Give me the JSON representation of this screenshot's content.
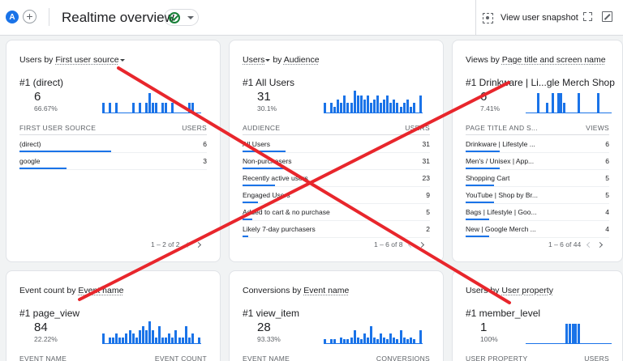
{
  "header": {
    "avatar_letter": "A",
    "add_label": "+",
    "title": "Realtime overview",
    "snapshot_label": "View user snapshot"
  },
  "colors": {
    "accent": "#1a73e8",
    "cross": "#e8262c",
    "status_ok": "#188038"
  },
  "cards": [
    {
      "title_a": "Users by ",
      "title_b": "First user source",
      "top_rank": "#1  (direct)",
      "top_value": "6",
      "top_percent": "66.67%",
      "col1": "FIRST USER SOURCE",
      "col2": "USERS",
      "rows": [
        {
          "name": "(direct)",
          "value": "6",
          "share": 0.67
        },
        {
          "name": "google",
          "value": "3",
          "share": 0.33
        }
      ],
      "pager": "1 – 2 of 2",
      "spark": [
        0.45,
        0,
        0.45,
        0,
        0.45,
        0,
        0,
        0,
        0,
        0.45,
        0,
        0.45,
        0,
        0.45,
        0.9,
        0.45,
        0.45,
        0,
        0.45,
        0.45,
        0,
        0.45,
        0,
        0,
        0,
        0,
        0.45,
        0.45,
        0,
        0
      ]
    },
    {
      "title_a": "Users",
      "title_b": "Audience",
      "top_rank": "#1  All Users",
      "top_value": "31",
      "top_percent": "30.1%",
      "col1": "AUDIENCE",
      "col2": "USERS",
      "rows": [
        {
          "name": "All Users",
          "value": "31",
          "share": 0.3
        },
        {
          "name": "Non-purchasers",
          "value": "31",
          "share": 0.3
        },
        {
          "name": "Recently active users",
          "value": "23",
          "share": 0.22
        },
        {
          "name": "Engaged Users",
          "value": "9",
          "share": 0.09
        },
        {
          "name": "Added to cart & no purchase",
          "value": "5",
          "share": 0.05
        },
        {
          "name": "Likely 7-day purchasers",
          "value": "2",
          "share": 0.02
        }
      ],
      "pager": "1 – 6 of 8",
      "spark": [
        0.45,
        0,
        0.45,
        0.3,
        0.6,
        0.45,
        0.8,
        0.45,
        0.45,
        1,
        0.8,
        0.8,
        0.6,
        0.8,
        0.45,
        0.6,
        0.8,
        0.45,
        0.6,
        0.8,
        0.45,
        0.6,
        0.45,
        0.3,
        0.45,
        0.6,
        0.3,
        0.45,
        0,
        0.8
      ]
    },
    {
      "title_a": "Views by ",
      "title_b": "Page title and screen name",
      "top_rank": "#1  Drinkware | Li...gle Merch Shop",
      "top_value": "6",
      "top_percent": "7.41%",
      "col1": "PAGE TITLE AND S...",
      "col2": "VIEWS",
      "rows": [
        {
          "name": "Drinkware | Lifestyle ...",
          "value": "6",
          "share": 0.3
        },
        {
          "name": "Men's / Unisex | App...",
          "value": "6",
          "share": 0.3
        },
        {
          "name": "Shopping Cart",
          "value": "5",
          "share": 0.25
        },
        {
          "name": "YouTube | Shop by Br...",
          "value": "5",
          "share": 0.25
        },
        {
          "name": "Bags | Lifestyle | Goo...",
          "value": "4",
          "share": 0.2
        },
        {
          "name": "New | Google Merch ...",
          "value": "4",
          "share": 0.2
        }
      ],
      "pager": "1 – 6 of 44",
      "spark": [
        0,
        0,
        0,
        0,
        0.9,
        0,
        0,
        0.45,
        0,
        0.9,
        0,
        0.9,
        0.9,
        0.45,
        0,
        0,
        0,
        0,
        0.9,
        0,
        0,
        0,
        0,
        0,
        0,
        0.9,
        0,
        0,
        0,
        0
      ]
    },
    {
      "title_a": "Event count by ",
      "title_b": "Event name",
      "top_rank": "#1  page_view",
      "top_value": "84",
      "top_percent": "22.22%",
      "col1": "EVENT NAME",
      "col2": "EVENT COUNT",
      "rows": [],
      "pager": "",
      "spark": [
        0.45,
        0,
        0.3,
        0.3,
        0.45,
        0.3,
        0.3,
        0.45,
        0.6,
        0.45,
        0.3,
        0.6,
        0.8,
        0.6,
        1,
        0.6,
        0.3,
        0.8,
        0.3,
        0.3,
        0.45,
        0.3,
        0.6,
        0.3,
        0.3,
        0.8,
        0.3,
        0.45,
        0,
        0.3
      ]
    },
    {
      "title_a": "Conversions by ",
      "title_b": "Event name",
      "top_rank": "#1  view_item",
      "top_value": "28",
      "top_percent": "93.33%",
      "col1": "EVENT NAME",
      "col2": "CONVERSIONS",
      "rows": [],
      "pager": "",
      "spark": [
        0.2,
        0,
        0.2,
        0.2,
        0,
        0.3,
        0.2,
        0.2,
        0.3,
        0.6,
        0.3,
        0.2,
        0.45,
        0.3,
        0.8,
        0.3,
        0.2,
        0.45,
        0.3,
        0.2,
        0.45,
        0.3,
        0.2,
        0.6,
        0.3,
        0.2,
        0.3,
        0.2,
        0,
        0.6
      ]
    },
    {
      "title_a": "Users by ",
      "title_b": "User property",
      "top_rank": "#1  member_level",
      "top_value": "1",
      "top_percent": "100%",
      "col1": "USER PROPERTY",
      "col2": "USERS",
      "rows": [],
      "pager": "",
      "spark": [
        0,
        0,
        0,
        0,
        0,
        0,
        0,
        0,
        0,
        0,
        0,
        0,
        0,
        0,
        0.9,
        0.9,
        0.9,
        0.9,
        0.9,
        0,
        0,
        0,
        0,
        0,
        0,
        0,
        0,
        0,
        0,
        0
      ]
    }
  ]
}
